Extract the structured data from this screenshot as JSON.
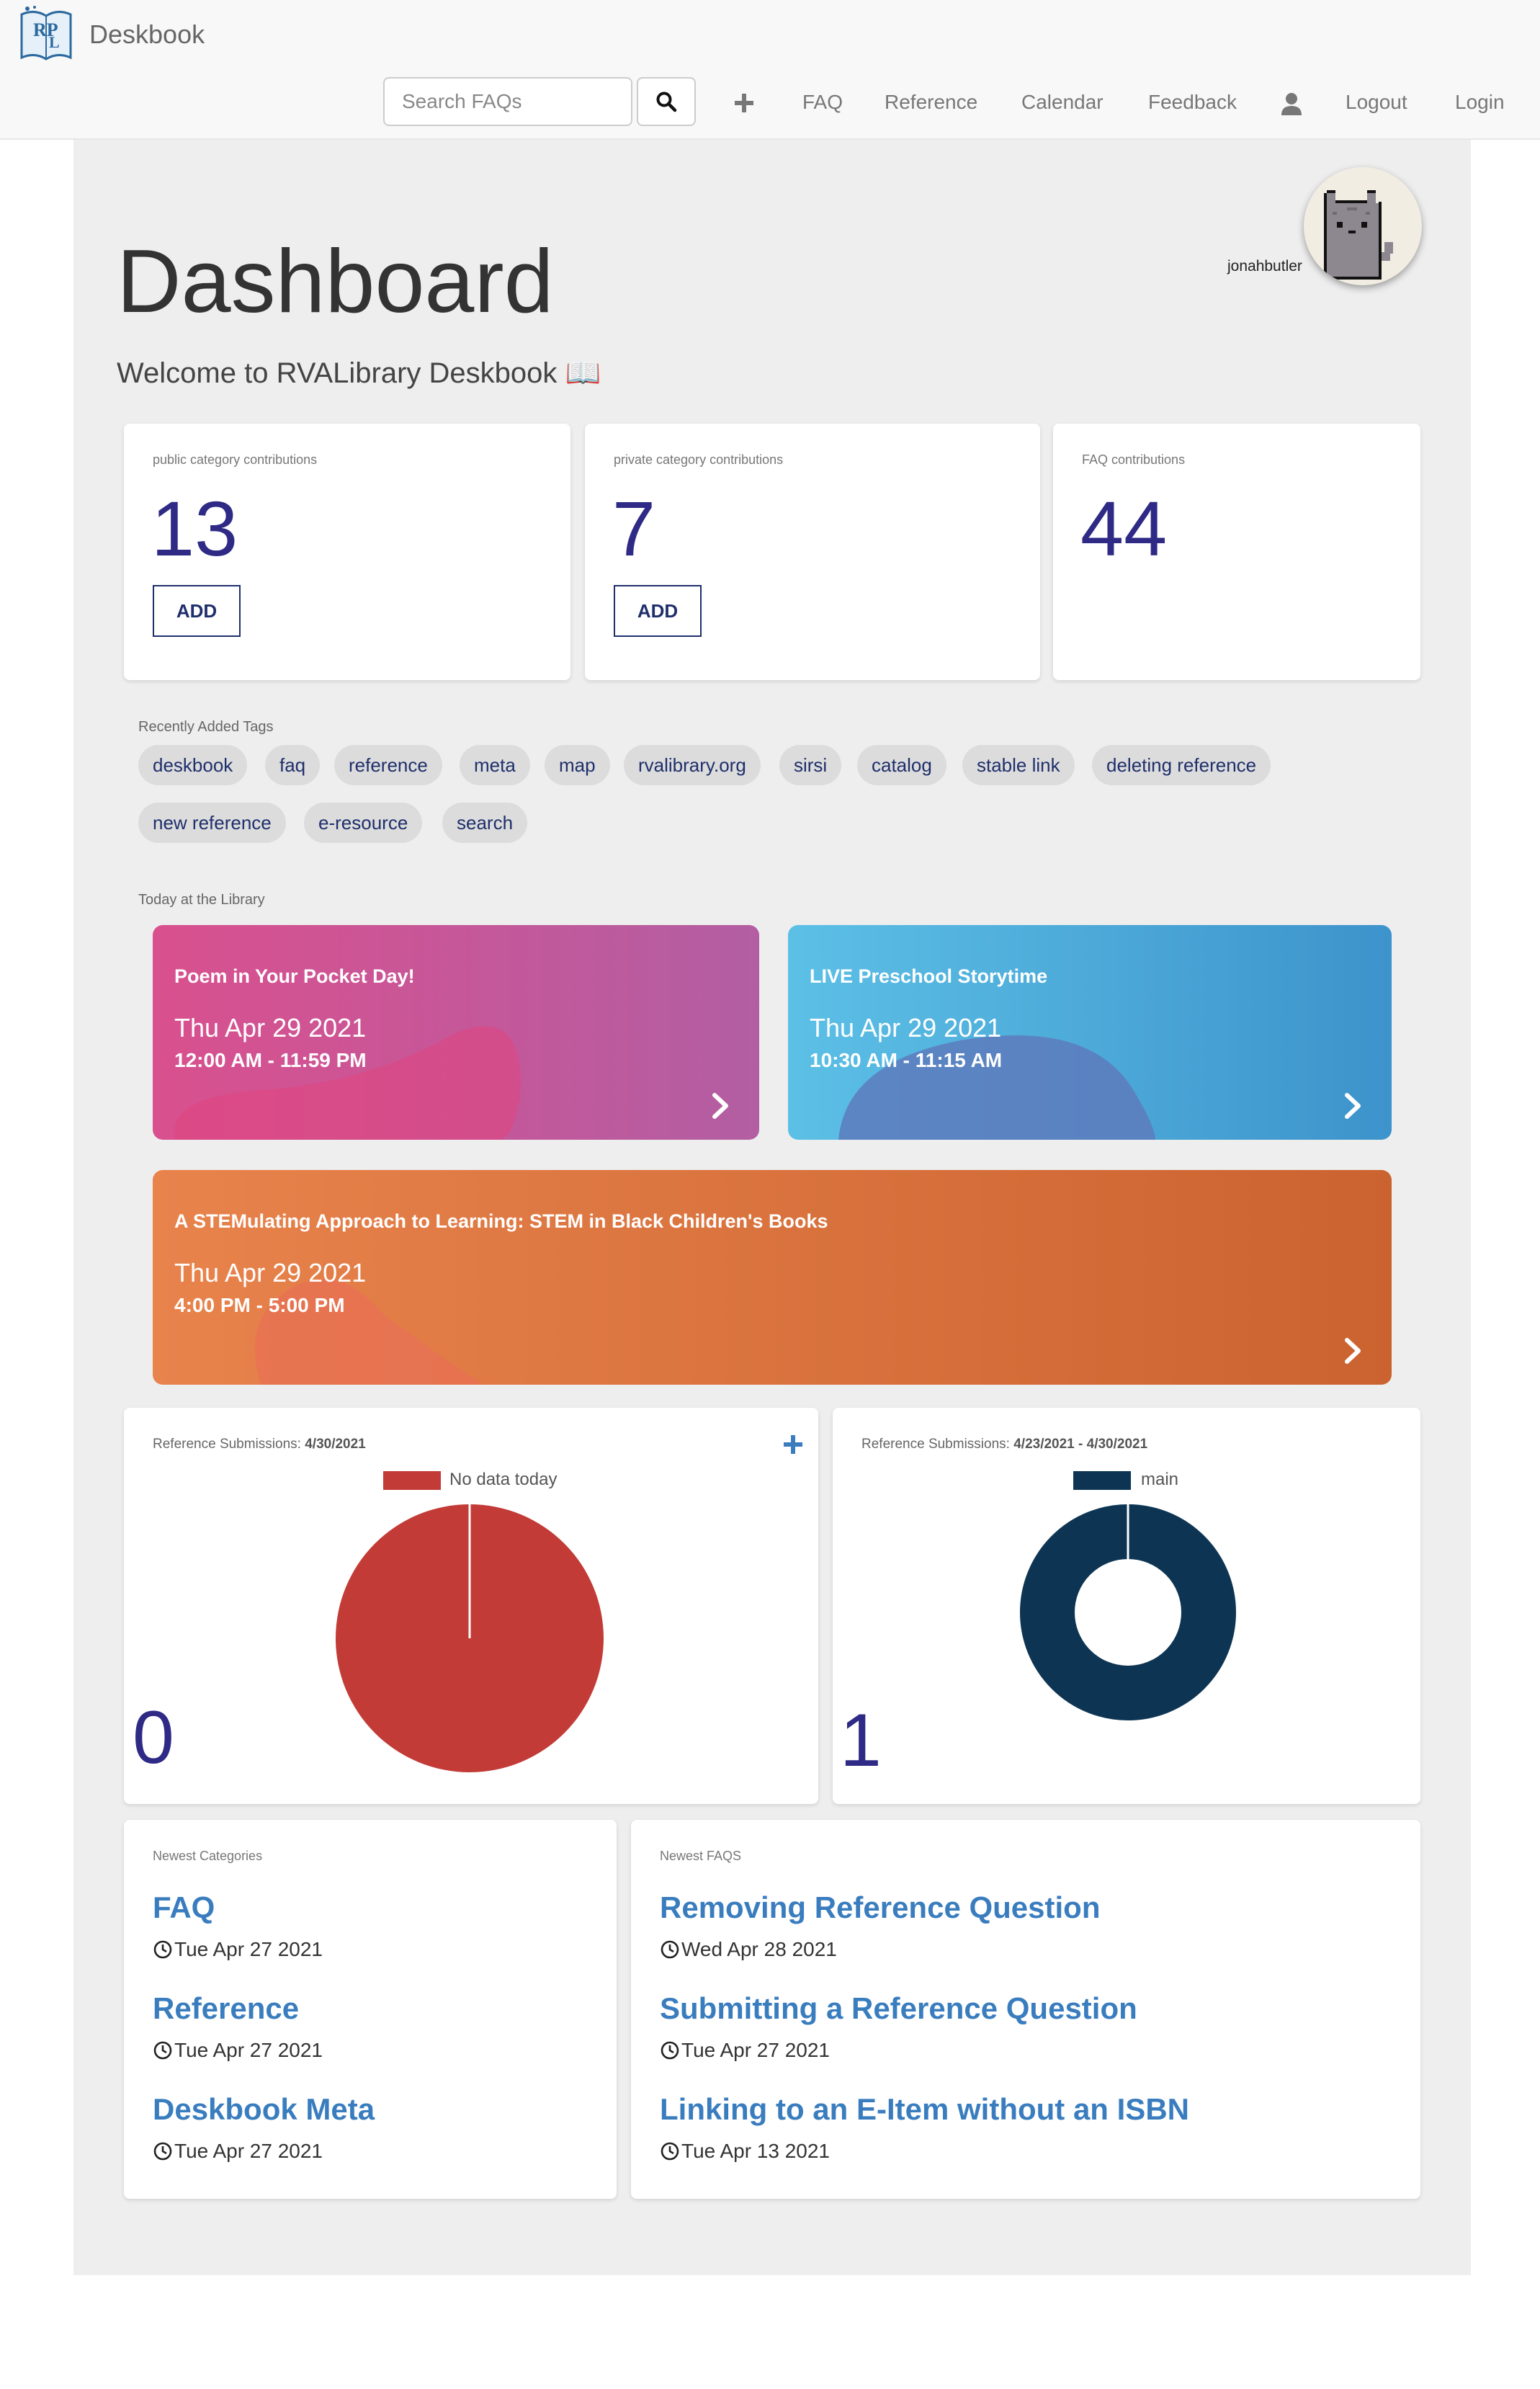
{
  "app": {
    "name": "Deskbook",
    "logo_letters": "RPL"
  },
  "search": {
    "placeholder": "Search FAQs"
  },
  "nav": {
    "items": [
      "FAQ",
      "Reference",
      "Calendar",
      "Feedback"
    ],
    "logout": "Logout",
    "login": "Login"
  },
  "user": {
    "name": "jonahbutler"
  },
  "page": {
    "title": "Dashboard",
    "welcome": "Welcome to RVALibrary Deskbook 📖"
  },
  "stats": [
    {
      "label": "public category contributions",
      "value": "13",
      "button": "ADD"
    },
    {
      "label": "private category contributions",
      "value": "7",
      "button": "ADD"
    },
    {
      "label": "FAQ contributions",
      "value": "44"
    }
  ],
  "tags": {
    "label": "Recently Added Tags",
    "items": [
      "deskbook",
      "faq",
      "reference",
      "meta",
      "map",
      "rvalibrary.org",
      "sirsi",
      "catalog",
      "stable link",
      "deleting reference",
      "new reference",
      "e-resource",
      "search"
    ]
  },
  "events": {
    "label": "Today at the Library",
    "items": [
      {
        "title": "Poem in Your Pocket Day!",
        "date": "Thu Apr 29 2021",
        "time": "12:00 AM - 11:59 PM"
      },
      {
        "title": "LIVE Preschool Storytime",
        "date": "Thu Apr 29 2021",
        "time": "10:30 AM - 11:15 AM"
      },
      {
        "title": "A STEMulating Approach to Learning: STEM in Black Children's Books",
        "date": "Thu Apr 29 2021",
        "time": "4:00 PM - 5:00 PM"
      }
    ]
  },
  "charts": {
    "daily": {
      "label_prefix": "Reference Submissions: ",
      "label_date": "4/30/2021",
      "count": "0",
      "legend": "No data today",
      "color": "#c23b36"
    },
    "weekly": {
      "label_prefix": "Reference Submissions: ",
      "label_date": "4/23/2021 - 4/30/2021",
      "count": "1",
      "legend": "main",
      "color": "#0d3553"
    }
  },
  "chart_data": [
    {
      "type": "pie",
      "title": "Reference Submissions: 4/30/2021",
      "categories": [
        "No data today"
      ],
      "values": [
        1
      ],
      "colors": [
        "#c23b36"
      ],
      "legend": "top"
    },
    {
      "type": "pie",
      "title": "Reference Submissions: 4/23/2021 - 4/30/2021",
      "categories": [
        "main"
      ],
      "values": [
        1
      ],
      "colors": [
        "#0d3553"
      ],
      "legend": "top"
    }
  ],
  "newest_categories": {
    "label": "Newest Categories",
    "items": [
      {
        "title": "FAQ",
        "date": "Tue Apr 27 2021"
      },
      {
        "title": "Reference",
        "date": "Tue Apr 27 2021"
      },
      {
        "title": "Deskbook Meta",
        "date": "Tue Apr 27 2021"
      }
    ]
  },
  "newest_faqs": {
    "label": "Newest FAQS",
    "items": [
      {
        "title": "Removing Reference Question",
        "date": "Wed Apr 28 2021"
      },
      {
        "title": "Submitting a Reference Question",
        "date": "Tue Apr 27 2021"
      },
      {
        "title": "Linking to an E-Item without an ISBN",
        "date": "Tue Apr 13 2021"
      }
    ]
  },
  "colors": {
    "accent": "#2e2a85",
    "link": "#3a7dbf",
    "navy": "#1f2f6b"
  }
}
